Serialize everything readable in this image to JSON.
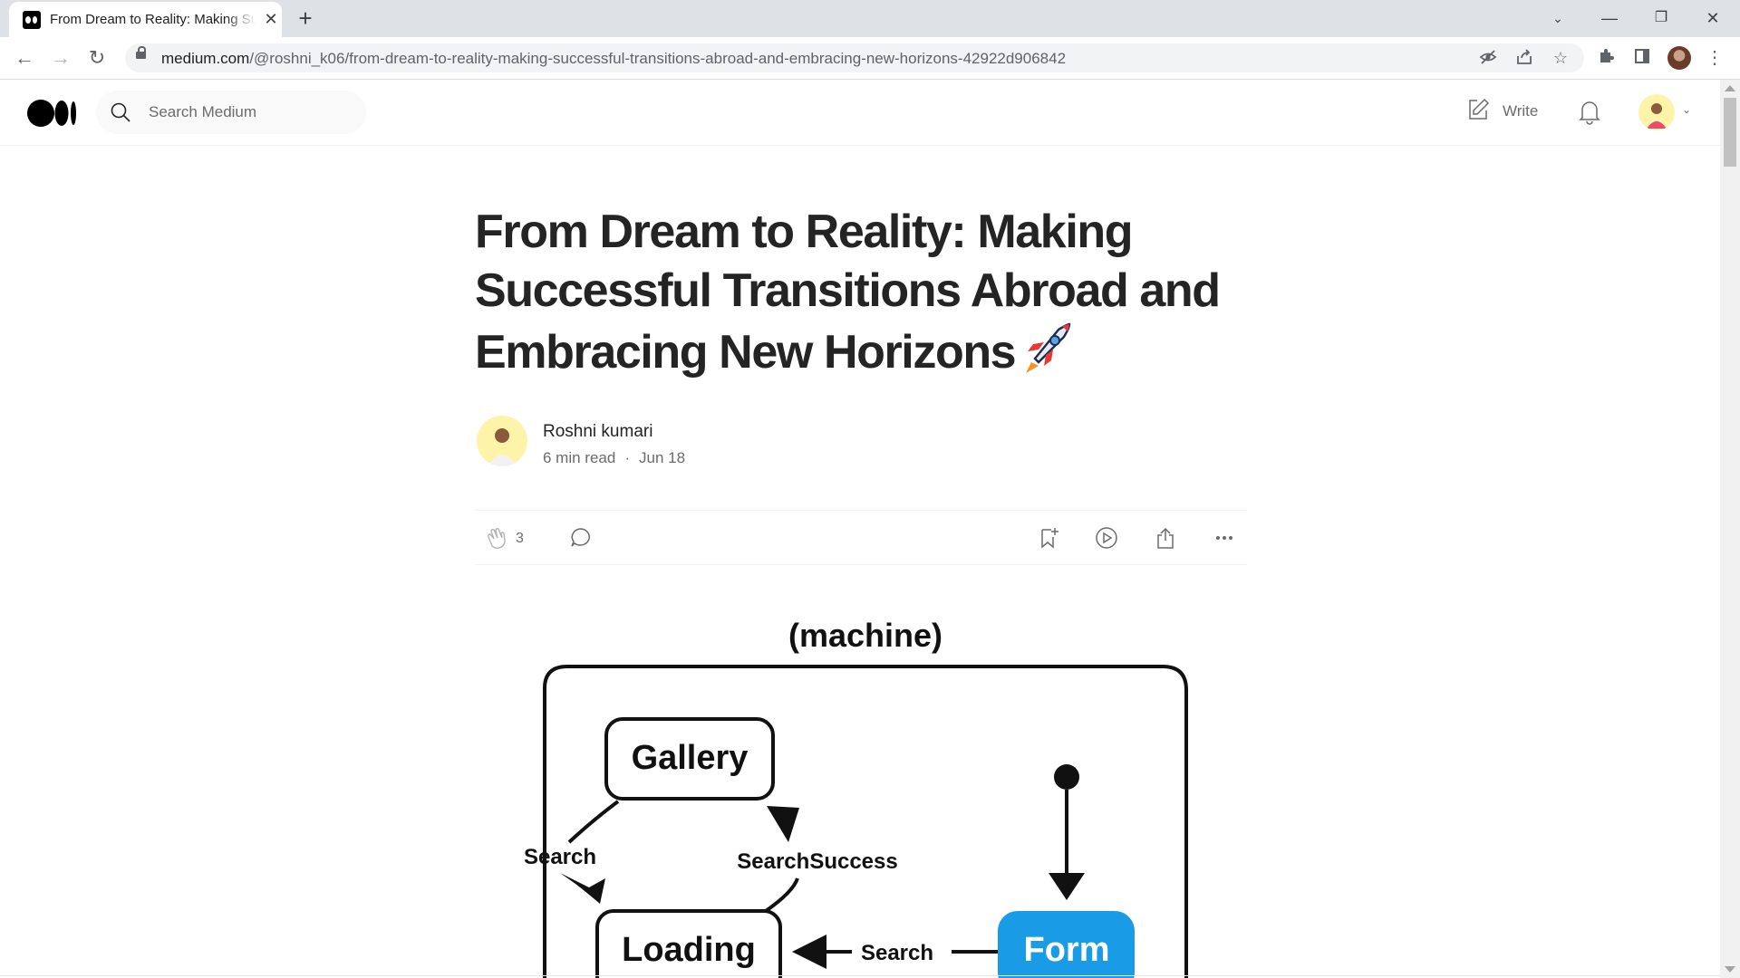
{
  "browser": {
    "tab_title": "From Dream to Reality: Making Successful Transitions Abroad and Embracing New Horizons",
    "url_host": "medium.com",
    "url_path": "/@roshni_k06/from-dream-to-reality-making-successful-transitions-abroad-and-embracing-new-horizons-42922d906842",
    "icons": [
      "back-icon",
      "forward-icon",
      "reload-icon",
      "lock-icon",
      "eye-off-icon",
      "share-icon",
      "star-icon",
      "extensions-icon",
      "sidepanel-icon",
      "menu-icon"
    ]
  },
  "header": {
    "search_placeholder": "Search Medium",
    "write_label": "Write"
  },
  "article": {
    "title": "From Dream to Reality: Making Successful Transitions Abroad and Embracing New Horizons",
    "author": "Roshni kumari",
    "read_time": "6 min read",
    "date": "Jun 18",
    "claps": "3"
  },
  "diagram": {
    "machine_label": "(machine)",
    "gallery": "Gallery",
    "loading": "Loading",
    "form": "Form",
    "search_left": "Search",
    "search_success": "SearchSuccess",
    "search_bottom": "Search"
  },
  "colors": {
    "form_box": "#1a9be6",
    "text": "#242424",
    "muted": "#6b6b6b"
  }
}
